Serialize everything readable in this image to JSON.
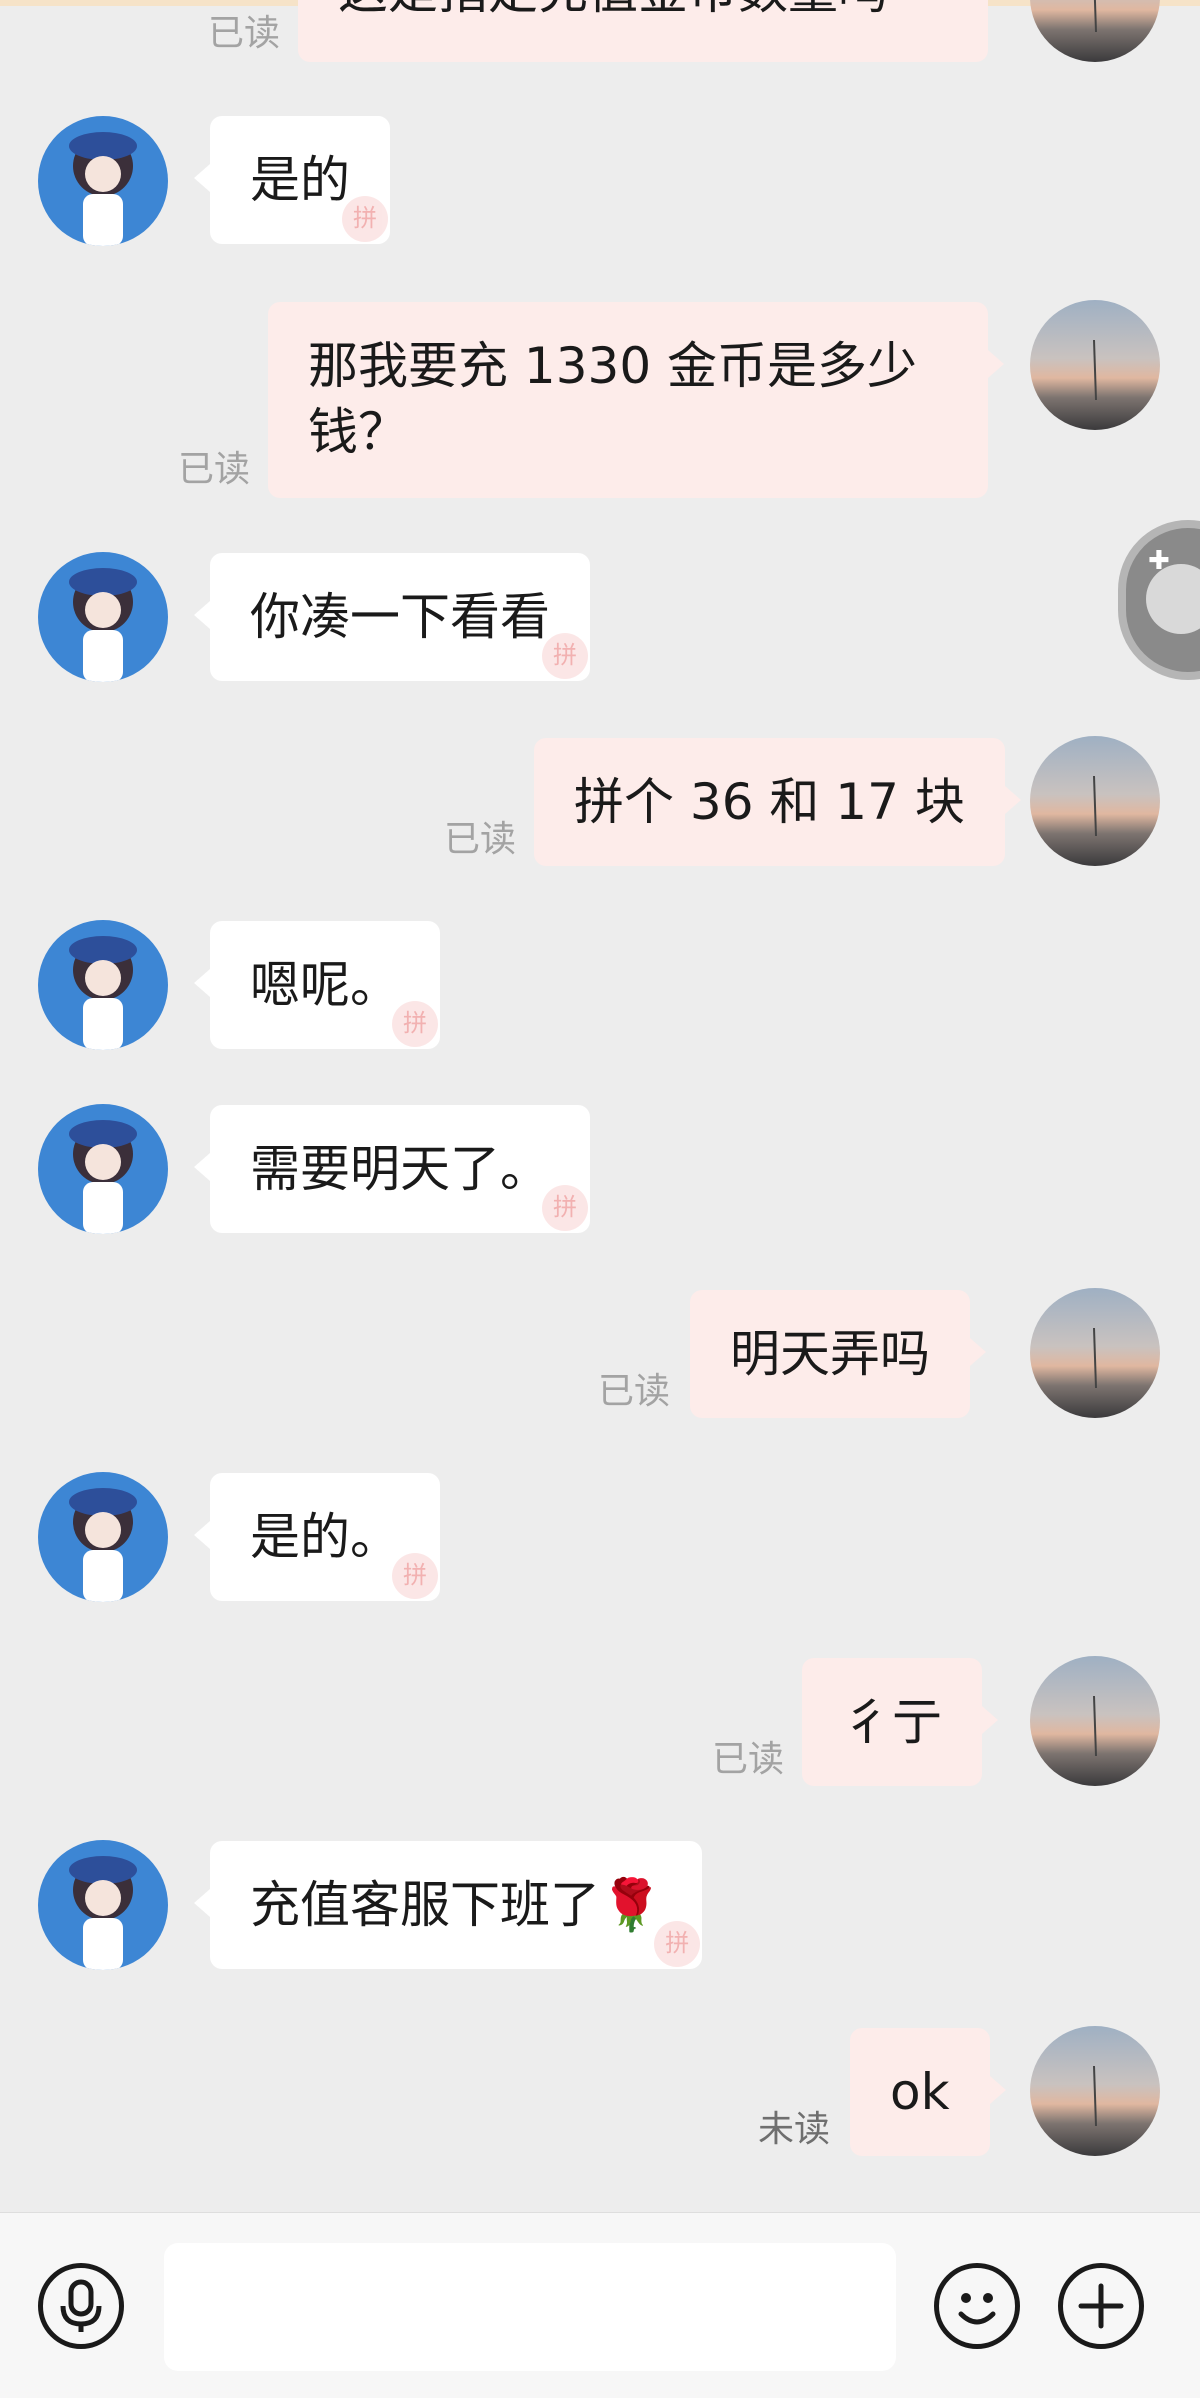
{
  "messages": [
    {
      "side": "right",
      "text": "这是指定充值金币数量吗",
      "status": "已读"
    },
    {
      "side": "left",
      "text": "是的"
    },
    {
      "side": "right",
      "text_line1": "那我要充 1330 金币是多少",
      "text_line2": "钱？",
      "status": "已读"
    },
    {
      "side": "left",
      "text": "你凑一下看看"
    },
    {
      "side": "right",
      "text": "拼个 36 和 17 块",
      "status": "已读"
    },
    {
      "side": "left",
      "text": "嗯呢。"
    },
    {
      "side": "left",
      "text": "需要明天了。"
    },
    {
      "side": "right",
      "text": "明天弄吗",
      "status": "已读"
    },
    {
      "side": "left",
      "text": "是的。"
    },
    {
      "side": "right",
      "text": "彳亍",
      "status": "已读"
    },
    {
      "side": "left",
      "text": "充值客服下班了🌹"
    },
    {
      "side": "right",
      "text": "ok",
      "status": "未读"
    }
  ],
  "input": {
    "placeholder": ""
  },
  "icons": {
    "voice": "microphone-icon",
    "emoji": "smiley-icon",
    "more": "plus-icon",
    "floating": "floating-assistant-icon"
  },
  "colors": {
    "background": "#ededed",
    "incoming_bubble": "#ffffff",
    "outgoing_bubble": "#fdecea",
    "read_status": "#a3a3a3"
  }
}
